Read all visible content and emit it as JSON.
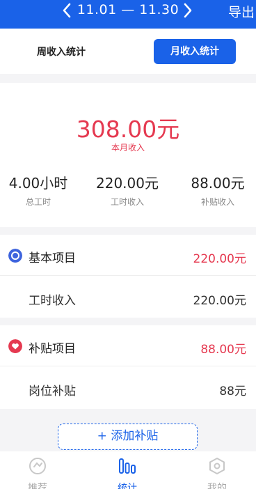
{
  "header": {
    "date_range": "11.01 — 11.30",
    "export_label": "导出"
  },
  "tabs": {
    "weekly": "周收入统计",
    "monthly": "月收入统计"
  },
  "summary": {
    "total_amount": "308.00元",
    "total_label": "本月收入",
    "stats": [
      {
        "value": "4.00小时",
        "label": "总工时"
      },
      {
        "value": "220.00元",
        "label": "工时收入"
      },
      {
        "value": "88.00元",
        "label": "补贴收入"
      }
    ]
  },
  "basic_section": {
    "title": "基本项目",
    "amount": "220.00元",
    "items": [
      {
        "label": "工时收入",
        "amount": "220.00元"
      }
    ]
  },
  "subsidy_section": {
    "title": "补贴项目",
    "amount": "88.00元",
    "items": [
      {
        "label": "岗位补贴",
        "amount": "88元"
      }
    ]
  },
  "add_subsidy_label": "+ 添加补贴",
  "bottom_nav": [
    {
      "label": "推荐",
      "icon": "recommend-icon"
    },
    {
      "label": "统计",
      "icon": "stats-icon"
    },
    {
      "label": "我的",
      "icon": "mine-icon"
    }
  ],
  "colors": {
    "primary": "#1a62e8",
    "accent_red": "#e53950",
    "background": "#f4f4f6"
  }
}
